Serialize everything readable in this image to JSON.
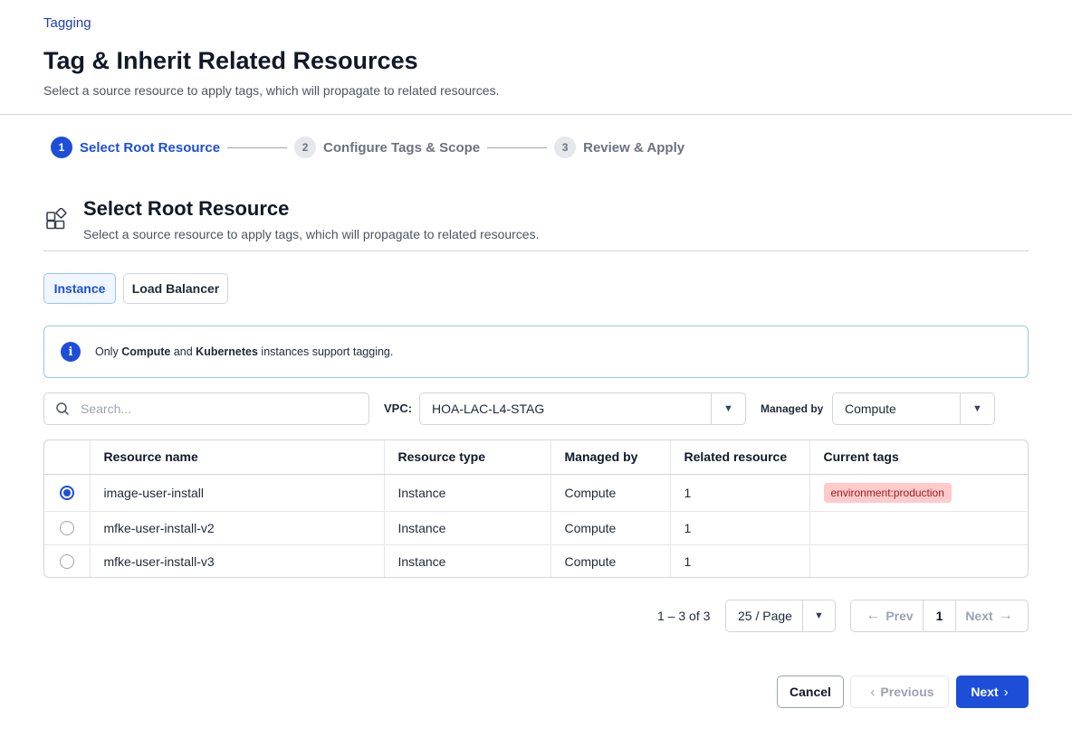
{
  "breadcrumb": "Tagging",
  "page": {
    "title": "Tag & Inherit Related Resources",
    "subtitle": "Select a source resource to apply tags, which will propagate to related resources."
  },
  "stepper": {
    "steps": [
      {
        "number": "1",
        "label": "Select Root Resource",
        "state": "active"
      },
      {
        "number": "2",
        "label": "Configure Tags & Scope",
        "state": "inactive"
      },
      {
        "number": "3",
        "label": "Review & Apply",
        "state": "inactive"
      }
    ]
  },
  "section": {
    "title": "Select Root Resource",
    "subtitle": "Select a source resource to apply tags, which will propagate to related resources.",
    "icon": "grid-icon"
  },
  "resource_types": {
    "instance": "Instance",
    "load_balancer": "Load Balancer",
    "selected": "Instance"
  },
  "info": {
    "prefix": "Only ",
    "bold1": "Compute",
    "middle": " and ",
    "bold2": "Kubernetes",
    "suffix": " instances support tagging."
  },
  "filters": {
    "search_placeholder": "Search...",
    "vpc_label": "VPC:",
    "vpc_value": "HOA-LAC-L4-STAG",
    "managed_by_label": "Managed by",
    "managed_by_value": "Compute"
  },
  "table": {
    "headers": [
      "Resource name",
      "Resource type",
      "Managed by",
      "Related resource",
      "Current tags"
    ],
    "rows": [
      {
        "name": "image-user-install",
        "type": "Instance",
        "managed_by": "Compute",
        "related": "1",
        "tag": "environment:production",
        "selected": true
      },
      {
        "name": "mfke-user-install-v2",
        "type": "Instance",
        "managed_by": "Compute",
        "related": "1",
        "tag": "",
        "selected": false
      },
      {
        "name": "mfke-user-install-v3",
        "type": "Instance",
        "managed_by": "Compute",
        "related": "1",
        "tag": "",
        "selected": false
      }
    ]
  },
  "pagination": {
    "count": "1 – 3 of 3",
    "page_size": "25 / Page",
    "prev": "Prev",
    "current": "1",
    "next": "Next"
  },
  "footer": {
    "cancel": "Cancel",
    "previous": "Previous",
    "next": "Next"
  },
  "colors": {
    "primary": "#1d4ed8",
    "tag_bg": "#fecaca",
    "tag_text": "#991b1b"
  }
}
